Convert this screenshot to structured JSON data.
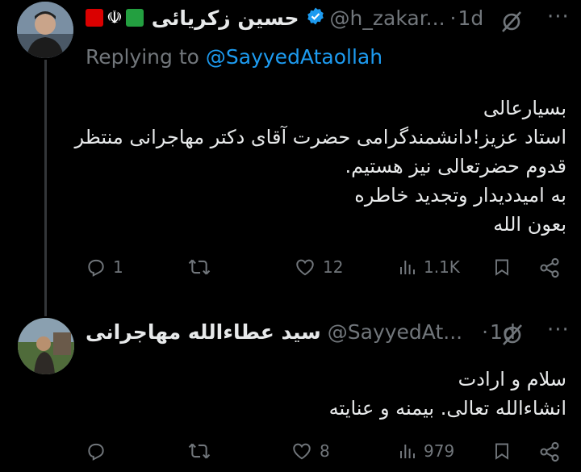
{
  "tweet1": {
    "display_name": "حسین زکریائی",
    "flag_emblem": "☫",
    "handle": "@h_zakar...",
    "separator": "·",
    "time": "1d",
    "more": "···",
    "replying_prefix": "Replying to",
    "replying_to": "@SayyedAtaollah",
    "body_lines": [
      "بسیارعالی",
      "استاد عزیز!دانشمندگرامی حضرت آقای دکتر مهاجرانی منتظر",
      "قدوم حضرتعالی نیز هستیم.",
      "به امیددیدار وتجدید خاطره",
      "بعون الله"
    ],
    "actions": {
      "replies": "1",
      "reposts": "",
      "likes": "12",
      "views": "1.1K"
    }
  },
  "tweet2": {
    "display_name": "سید عطاءالله مهاجرانی",
    "handle": "@SayyedAt...",
    "separator": "·",
    "time": "1d",
    "more": "···",
    "body_lines": [
      "سلام و ارادت",
      "انشاءالله تعالی. بیمنه و عنایته"
    ],
    "actions": {
      "replies": "",
      "reposts": "",
      "likes": "8",
      "views": "979"
    }
  },
  "icons": {
    "reply": "reply-icon",
    "repost": "repost-icon",
    "like": "heart-icon",
    "views": "views-icon",
    "bookmark": "bookmark-icon",
    "share": "share-icon",
    "grok": "grok-icon",
    "verified": "verified-badge-icon"
  },
  "colors": {
    "background": "#000000",
    "text": "#e7e9ea",
    "muted": "#71767b",
    "link": "#1d9bf0",
    "verified": "#1d9bf0",
    "flag_red": "#da0000",
    "flag_green": "#239f40"
  }
}
